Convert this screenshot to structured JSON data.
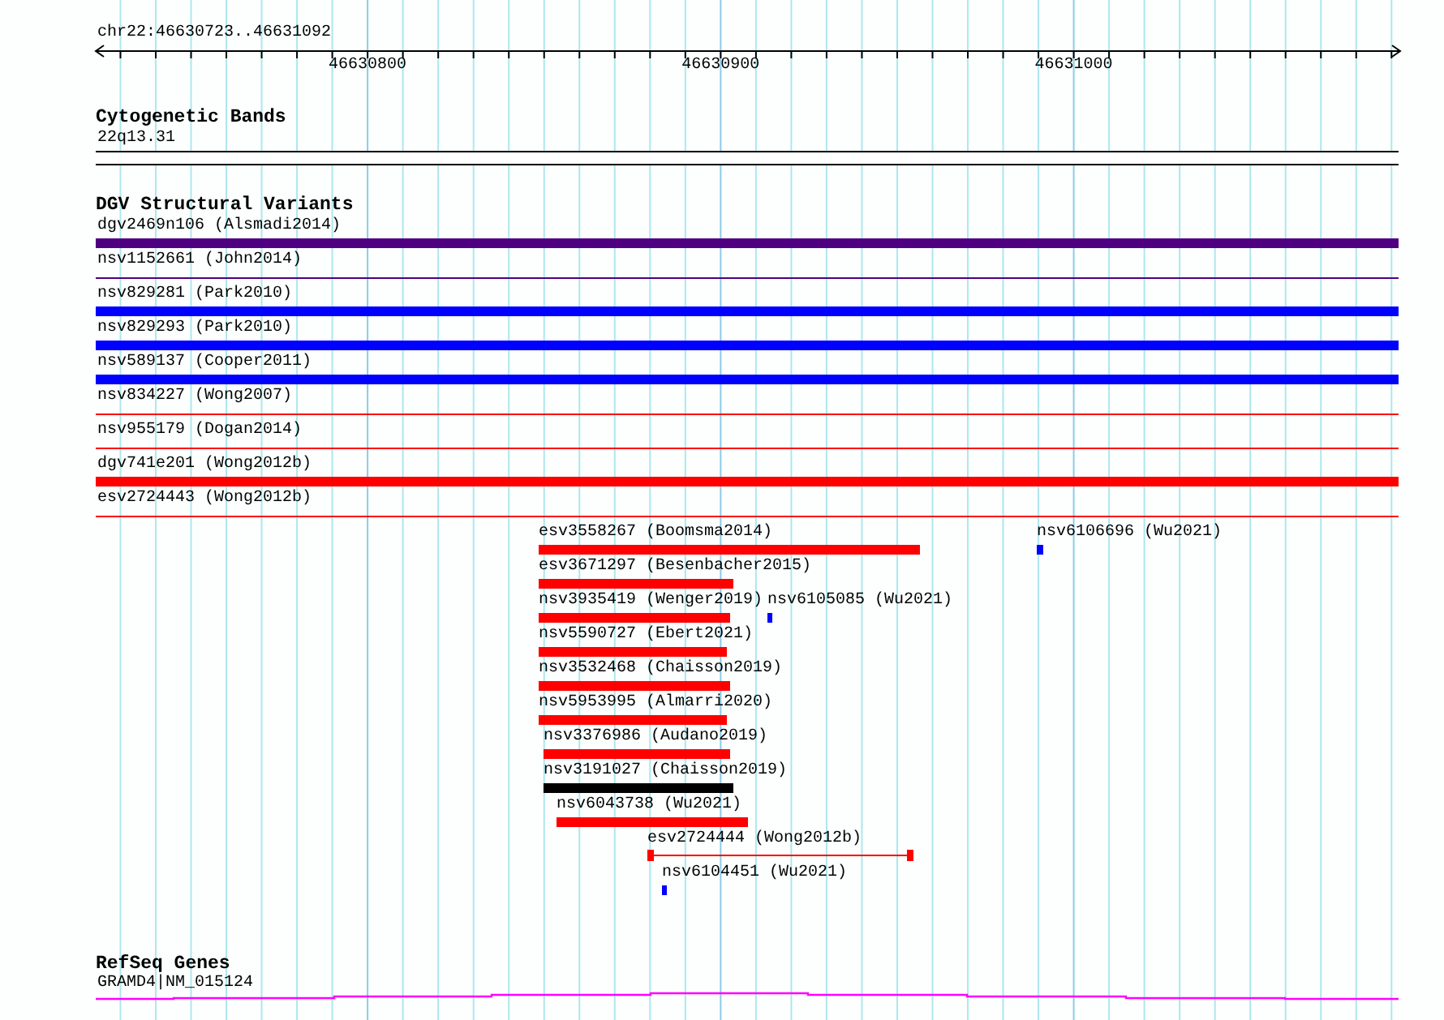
{
  "ruler": {
    "region": "chr22:46630723..46631092",
    "ticks": [
      "46630800",
      "46630900",
      "46631000"
    ]
  },
  "cytogenetic_bands": {
    "title": "Cytogenetic Bands",
    "band": "22q13.31"
  },
  "dgv": {
    "title": "DGV Structural Variants",
    "rows": [
      {
        "label": "dgv2469n106 (Alsmadi2014)",
        "color": "#4f0080",
        "kind": "thick"
      },
      {
        "label": "nsv1152661 (John2014)",
        "color": "#4f0080",
        "kind": "thin"
      },
      {
        "label": "nsv829281 (Park2010)",
        "color": "#0000ff",
        "kind": "thick"
      },
      {
        "label": "nsv829293 (Park2010)",
        "color": "#0000ff",
        "kind": "thick"
      },
      {
        "label": "nsv589137 (Cooper2011)",
        "color": "#0000ff",
        "kind": "thick"
      },
      {
        "label": "nsv834227 (Wong2007)",
        "color": "#ff0000",
        "kind": "thin"
      },
      {
        "label": "nsv955179 (Dogan2014)",
        "color": "#ff0000",
        "kind": "thin"
      },
      {
        "label": "dgv741e201 (Wong2012b)",
        "color": "#ff0000",
        "kind": "thick"
      },
      {
        "label": "esv2724443 (Wong2012b)",
        "color": "#ff0000",
        "kind": "thin"
      }
    ],
    "stacked": [
      {
        "label": "esv3558267 (Boomsma2014)",
        "color": "#ff0000",
        "kind": "bar"
      },
      {
        "label": "nsv6106696 (Wu2021)",
        "color": "#0000ff",
        "kind": "bar"
      },
      {
        "label": "esv3671297 (Besenbacher2015)",
        "color": "#ff0000",
        "kind": "bar"
      },
      {
        "label": "nsv3935419 (Wenger2019)",
        "color": "#ff0000",
        "kind": "bar"
      },
      {
        "label": "nsv6105085 (Wu2021)",
        "color": "#0000ff",
        "kind": "bar"
      },
      {
        "label": "nsv5590727 (Ebert2021)",
        "color": "#ff0000",
        "kind": "bar"
      },
      {
        "label": "nsv3532468 (Chaisson2019)",
        "color": "#ff0000",
        "kind": "bar"
      },
      {
        "label": "nsv5953995 (Almarri2020)",
        "color": "#ff0000",
        "kind": "bar"
      },
      {
        "label": "nsv3376986 (Audano2019)",
        "color": "#ff0000",
        "kind": "bar"
      },
      {
        "label": "nsv3191027 (Chaisson2019)",
        "color": "#000000",
        "kind": "bar"
      },
      {
        "label": "nsv6043738 (Wu2021)",
        "color": "#ff0000",
        "kind": "bar"
      },
      {
        "label": "esv2724444 (Wong2012b)",
        "color": "#ff0000",
        "kind": "split"
      },
      {
        "label": "nsv6104451 (Wu2021)",
        "color": "#0000ff",
        "kind": "bar"
      }
    ]
  },
  "refseq": {
    "title": "RefSeq Genes",
    "gene": "GRAMD4|NM_015124"
  }
}
